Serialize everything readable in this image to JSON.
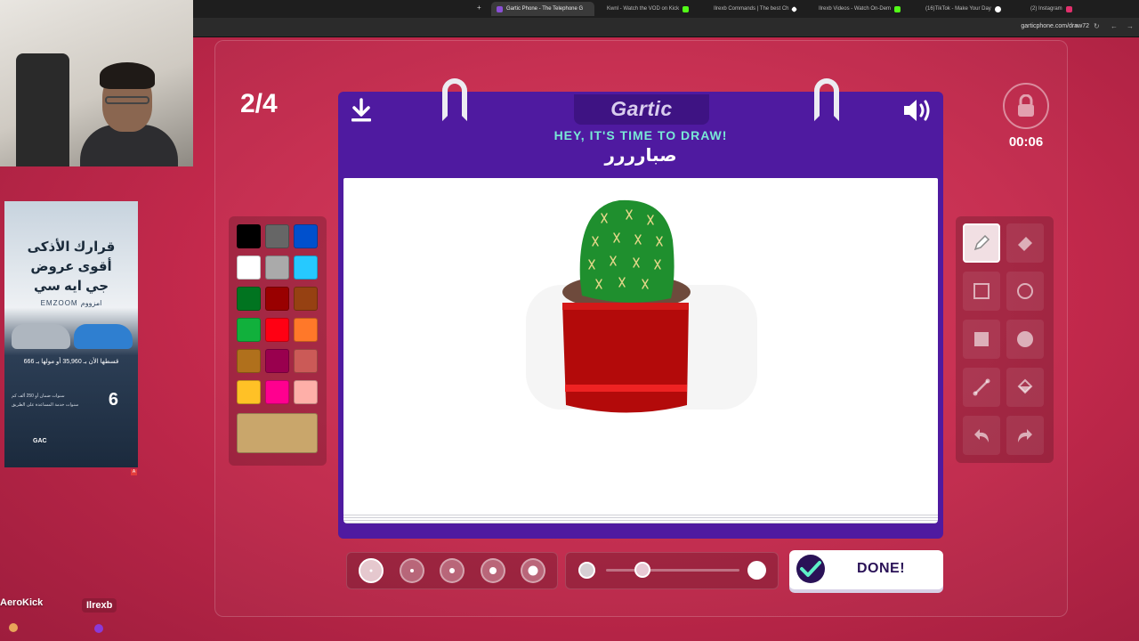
{
  "browser": {
    "tabs": [
      {
        "title": "Gartic Phone - The Telephone G",
        "active": true,
        "color": "#8a4fd6"
      },
      {
        "title": "Kwnl - Watch the VOD on Kick",
        "active": false,
        "color": "#53fc18"
      },
      {
        "title": "Ilrexb Commands | The best Ch",
        "active": false,
        "color": "#ffffff"
      },
      {
        "title": "Ilrexb Videos - Watch On-Dem",
        "active": false,
        "color": "#53fc18"
      },
      {
        "title": "(16)TikTok - Make Your Day",
        "active": false,
        "color": "#ffffff"
      },
      {
        "title": "(2) Instagram",
        "active": false,
        "color": "#e1306c"
      }
    ],
    "url": "garticphone.com/draw72"
  },
  "overlay": {
    "ad": {
      "line1": "قرارك الأذكى",
      "line2": "أقوى عروض",
      "line3": "جي ايه سي",
      "brand": "EMZOOM امزووم",
      "price_text": "قسطها الأن بـ 35,960 أو مولها بـ 666",
      "six": "6",
      "years_text": "سنوات ضمان أو 250 ألف كم",
      "service_text": "سنوات خدمة المساعدة على الطريق",
      "gac": "GAC"
    },
    "chatters": [
      "AeroKick",
      "Ilrexb"
    ]
  },
  "game": {
    "round": "2/4",
    "logo": "Gartic",
    "heading": "HEY, IT'S TIME TO DRAW!",
    "subject": "صبارررر",
    "timer": "00:06",
    "done_label": "DONE!",
    "palette": [
      "#000000",
      "#666666",
      "#0050cd",
      "#ffffff",
      "#aaaaaa",
      "#26c9ff",
      "#017420",
      "#990000",
      "#964112",
      "#11b03c",
      "#ff0013",
      "#ff7829",
      "#b0701c",
      "#99004e",
      "#cb5a57",
      "#ffc126",
      "#ff008f",
      "#feafa8"
    ],
    "current_color": "#c9a66b",
    "tools": [
      "pencil-icon",
      "eraser-icon",
      "rectangle-outline-icon",
      "ellipse-outline-icon",
      "rectangle-filled-icon",
      "ellipse-filled-icon",
      "line-icon",
      "fill-bucket-icon",
      "undo-icon",
      "redo-icon"
    ],
    "selected_tool": "pencil-icon",
    "brush_sizes": [
      1,
      2,
      3,
      4,
      5
    ],
    "selected_size": 1,
    "opacity_value": 0.27
  }
}
